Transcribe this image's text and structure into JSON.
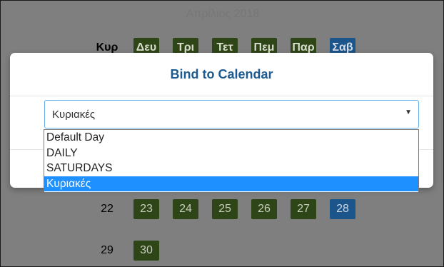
{
  "calendar": {
    "title": "Απρίλιος 2018",
    "weekdays": [
      {
        "label": "Κυρ",
        "style": "plain"
      },
      {
        "label": "Δευ",
        "style": "green"
      },
      {
        "label": "Τρι",
        "style": "green"
      },
      {
        "label": "Τετ",
        "style": "green"
      },
      {
        "label": "Πεμ",
        "style": "green"
      },
      {
        "label": "Παρ",
        "style": "green"
      },
      {
        "label": "Σαβ",
        "style": "blue"
      }
    ],
    "rows": [
      [
        {
          "label": "22",
          "style": "plain"
        },
        {
          "label": "23",
          "style": "green"
        },
        {
          "label": "24",
          "style": "green"
        },
        {
          "label": "25",
          "style": "green"
        },
        {
          "label": "26",
          "style": "green"
        },
        {
          "label": "27",
          "style": "green"
        },
        {
          "label": "28",
          "style": "blue"
        }
      ],
      [
        {
          "label": "29",
          "style": "plain"
        },
        {
          "label": "30",
          "style": "green"
        }
      ]
    ]
  },
  "modal": {
    "title": "Bind to Calendar",
    "select": {
      "value": "Κυριακές",
      "arrow_icon": "triangle-down",
      "options": [
        "Default Day",
        "DAILY",
        "SATURDAYS",
        "Κυριακές"
      ],
      "selected_index": 3
    }
  },
  "colors": {
    "day_green": "#2e4617",
    "day_blue": "#1b558c",
    "modal_title": "#1c5a8f",
    "option_highlight": "#1e90ff"
  }
}
